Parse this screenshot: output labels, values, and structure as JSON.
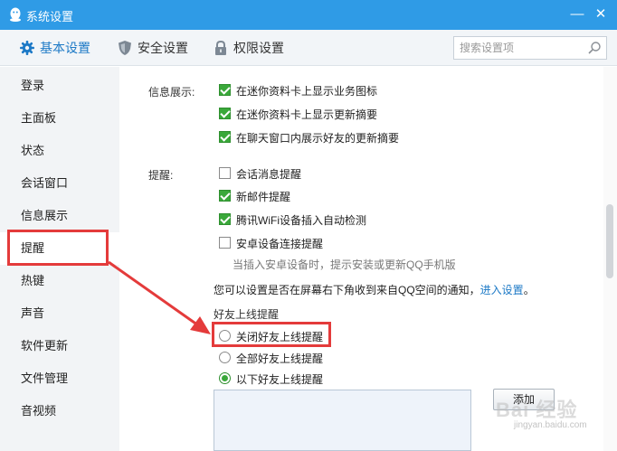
{
  "window": {
    "title": "系统设置",
    "minimize_glyph": "—",
    "close_glyph": "✕"
  },
  "tabs": [
    {
      "label": "基本设置",
      "icon": "gear-icon",
      "active": true
    },
    {
      "label": "安全设置",
      "icon": "shield-icon",
      "active": false
    },
    {
      "label": "权限设置",
      "icon": "lock-icon",
      "active": false
    }
  ],
  "search": {
    "placeholder": "搜索设置项",
    "value": ""
  },
  "sidebar": {
    "items": [
      {
        "label": "登录"
      },
      {
        "label": "主面板"
      },
      {
        "label": "状态"
      },
      {
        "label": "会话窗口"
      },
      {
        "label": "信息展示"
      },
      {
        "label": "提醒",
        "active": true
      },
      {
        "label": "热键"
      },
      {
        "label": "声音"
      },
      {
        "label": "软件更新"
      },
      {
        "label": "文件管理"
      },
      {
        "label": "音视频"
      }
    ]
  },
  "info_display": {
    "label": "信息展示:",
    "options": [
      {
        "label": "在迷你资料卡上显示业务图标",
        "checked": true
      },
      {
        "label": "在迷你资料卡上显示更新摘要",
        "checked": true
      },
      {
        "label": "在聊天窗口内展示好友的更新摘要",
        "checked": true
      }
    ]
  },
  "reminders": {
    "label": "提醒:",
    "options": [
      {
        "label": "会话消息提醒",
        "checked": false
      },
      {
        "label": "新邮件提醒",
        "checked": true
      },
      {
        "label": "腾讯WiFi设备插入自动检测",
        "checked": true
      },
      {
        "label": "安卓设备连接提醒",
        "checked": false
      }
    ],
    "android_hint": "当插入安卓设备时，提示安装或更新QQ手机版",
    "qzone_notice": "您可以设置是否在屏幕右下角收到来自QQ空间的通知，",
    "qzone_link": "进入设置",
    "qzone_end": "。"
  },
  "friend_online": {
    "heading": "好友上线提醒",
    "options": [
      {
        "label": "关闭好友上线提醒",
        "selected": false
      },
      {
        "label": "全部好友上线提醒",
        "selected": false
      },
      {
        "label": "以下好友上线提醒",
        "selected": true
      }
    ],
    "add_button": "添加"
  },
  "watermark": {
    "text": "Bai 经验",
    "sub": "jingyan.baidu.com"
  },
  "colors": {
    "titlebar": "#2f9be6",
    "accent": "#1c79c6",
    "check_green": "#3aa83a",
    "annotation_red": "#e43b3b"
  }
}
